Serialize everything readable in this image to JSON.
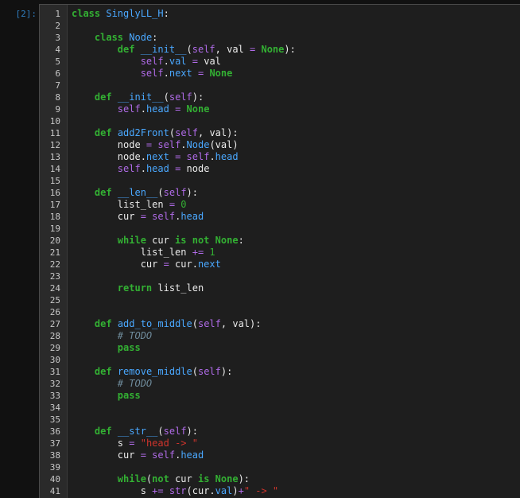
{
  "cell": {
    "prompt": "[2]:",
    "lines": [
      {
        "n": "1",
        "tokens": [
          [
            "kw",
            "class"
          ],
          [
            "text",
            " "
          ],
          [
            "name",
            "SinglyLL_H"
          ],
          [
            "text",
            ":"
          ]
        ]
      },
      {
        "n": "2",
        "tokens": []
      },
      {
        "n": "3",
        "tokens": [
          [
            "text",
            "    "
          ],
          [
            "kw",
            "class"
          ],
          [
            "text",
            " "
          ],
          [
            "name",
            "Node"
          ],
          [
            "text",
            ":"
          ]
        ]
      },
      {
        "n": "4",
        "tokens": [
          [
            "text",
            "        "
          ],
          [
            "kw",
            "def"
          ],
          [
            "text",
            " "
          ],
          [
            "name",
            "__init__"
          ],
          [
            "text",
            "("
          ],
          [
            "self",
            "self"
          ],
          [
            "text",
            ", val "
          ],
          [
            "op",
            "="
          ],
          [
            "text",
            " "
          ],
          [
            "none",
            "None"
          ],
          [
            "text",
            "):"
          ]
        ]
      },
      {
        "n": "5",
        "tokens": [
          [
            "text",
            "            "
          ],
          [
            "self",
            "self"
          ],
          [
            "text",
            "."
          ],
          [
            "attr",
            "val"
          ],
          [
            "text",
            " "
          ],
          [
            "op",
            "="
          ],
          [
            "text",
            " val"
          ]
        ]
      },
      {
        "n": "6",
        "tokens": [
          [
            "text",
            "            "
          ],
          [
            "self",
            "self"
          ],
          [
            "text",
            "."
          ],
          [
            "attr",
            "next"
          ],
          [
            "text",
            " "
          ],
          [
            "op",
            "="
          ],
          [
            "text",
            " "
          ],
          [
            "none",
            "None"
          ]
        ]
      },
      {
        "n": "7",
        "tokens": []
      },
      {
        "n": "8",
        "tokens": [
          [
            "text",
            "    "
          ],
          [
            "kw",
            "def"
          ],
          [
            "text",
            " "
          ],
          [
            "name",
            "__init__"
          ],
          [
            "text",
            "("
          ],
          [
            "self",
            "self"
          ],
          [
            "text",
            "):"
          ]
        ]
      },
      {
        "n": "9",
        "tokens": [
          [
            "text",
            "        "
          ],
          [
            "self",
            "self"
          ],
          [
            "text",
            "."
          ],
          [
            "attr",
            "head"
          ],
          [
            "text",
            " "
          ],
          [
            "op",
            "="
          ],
          [
            "text",
            " "
          ],
          [
            "none",
            "None"
          ]
        ]
      },
      {
        "n": "10",
        "tokens": []
      },
      {
        "n": "11",
        "tokens": [
          [
            "text",
            "    "
          ],
          [
            "kw",
            "def"
          ],
          [
            "text",
            " "
          ],
          [
            "name",
            "add2Front"
          ],
          [
            "text",
            "("
          ],
          [
            "self",
            "self"
          ],
          [
            "text",
            ", val):"
          ]
        ]
      },
      {
        "n": "12",
        "tokens": [
          [
            "text",
            "        node "
          ],
          [
            "op",
            "="
          ],
          [
            "text",
            " "
          ],
          [
            "self",
            "self"
          ],
          [
            "text",
            "."
          ],
          [
            "attr",
            "Node"
          ],
          [
            "text",
            "(val)"
          ]
        ]
      },
      {
        "n": "13",
        "tokens": [
          [
            "text",
            "        node."
          ],
          [
            "attr",
            "next"
          ],
          [
            "text",
            " "
          ],
          [
            "op",
            "="
          ],
          [
            "text",
            " "
          ],
          [
            "self",
            "self"
          ],
          [
            "text",
            "."
          ],
          [
            "attr",
            "head"
          ]
        ]
      },
      {
        "n": "14",
        "tokens": [
          [
            "text",
            "        "
          ],
          [
            "self",
            "self"
          ],
          [
            "text",
            "."
          ],
          [
            "attr",
            "head"
          ],
          [
            "text",
            " "
          ],
          [
            "op",
            "="
          ],
          [
            "text",
            " node"
          ]
        ]
      },
      {
        "n": "15",
        "tokens": []
      },
      {
        "n": "16",
        "tokens": [
          [
            "text",
            "    "
          ],
          [
            "kw",
            "def"
          ],
          [
            "text",
            " "
          ],
          [
            "name",
            "__len__"
          ],
          [
            "text",
            "("
          ],
          [
            "self",
            "self"
          ],
          [
            "text",
            "):"
          ]
        ]
      },
      {
        "n": "17",
        "tokens": [
          [
            "text",
            "        list_len "
          ],
          [
            "op",
            "="
          ],
          [
            "text",
            " "
          ],
          [
            "num",
            "0"
          ]
        ]
      },
      {
        "n": "18",
        "tokens": [
          [
            "text",
            "        cur "
          ],
          [
            "op",
            "="
          ],
          [
            "text",
            " "
          ],
          [
            "self",
            "self"
          ],
          [
            "text",
            "."
          ],
          [
            "attr",
            "head"
          ]
        ]
      },
      {
        "n": "19",
        "tokens": []
      },
      {
        "n": "20",
        "tokens": [
          [
            "text",
            "        "
          ],
          [
            "kw",
            "while"
          ],
          [
            "text",
            " cur "
          ],
          [
            "kw",
            "is"
          ],
          [
            "text",
            " "
          ],
          [
            "kw",
            "not"
          ],
          [
            "text",
            " "
          ],
          [
            "none",
            "None"
          ],
          [
            "text",
            ":"
          ]
        ]
      },
      {
        "n": "21",
        "tokens": [
          [
            "text",
            "            list_len "
          ],
          [
            "op",
            "+="
          ],
          [
            "text",
            " "
          ],
          [
            "num",
            "1"
          ]
        ]
      },
      {
        "n": "22",
        "tokens": [
          [
            "text",
            "            cur "
          ],
          [
            "op",
            "="
          ],
          [
            "text",
            " cur."
          ],
          [
            "attr",
            "next"
          ]
        ]
      },
      {
        "n": "23",
        "tokens": []
      },
      {
        "n": "24",
        "tokens": [
          [
            "text",
            "        "
          ],
          [
            "kw",
            "return"
          ],
          [
            "text",
            " list_len"
          ]
        ]
      },
      {
        "n": "25",
        "tokens": []
      },
      {
        "n": "26",
        "tokens": []
      },
      {
        "n": "27",
        "tokens": [
          [
            "text",
            "    "
          ],
          [
            "kw",
            "def"
          ],
          [
            "text",
            " "
          ],
          [
            "name",
            "add_to_middle"
          ],
          [
            "text",
            "("
          ],
          [
            "self",
            "self"
          ],
          [
            "text",
            ", val):"
          ]
        ]
      },
      {
        "n": "28",
        "tokens": [
          [
            "text",
            "        "
          ],
          [
            "cm",
            "# TODO"
          ]
        ]
      },
      {
        "n": "29",
        "tokens": [
          [
            "text",
            "        "
          ],
          [
            "kw",
            "pass"
          ]
        ]
      },
      {
        "n": "30",
        "tokens": []
      },
      {
        "n": "31",
        "tokens": [
          [
            "text",
            "    "
          ],
          [
            "kw",
            "def"
          ],
          [
            "text",
            " "
          ],
          [
            "name",
            "remove_middle"
          ],
          [
            "text",
            "("
          ],
          [
            "self",
            "self"
          ],
          [
            "text",
            "):"
          ]
        ]
      },
      {
        "n": "32",
        "tokens": [
          [
            "text",
            "        "
          ],
          [
            "cm",
            "# TODO"
          ]
        ]
      },
      {
        "n": "33",
        "tokens": [
          [
            "text",
            "        "
          ],
          [
            "kw",
            "pass"
          ]
        ]
      },
      {
        "n": "34",
        "tokens": []
      },
      {
        "n": "35",
        "tokens": []
      },
      {
        "n": "36",
        "tokens": [
          [
            "text",
            "    "
          ],
          [
            "kw",
            "def"
          ],
          [
            "text",
            " "
          ],
          [
            "name",
            "__str__"
          ],
          [
            "text",
            "("
          ],
          [
            "self",
            "self"
          ],
          [
            "text",
            "):"
          ]
        ]
      },
      {
        "n": "37",
        "tokens": [
          [
            "text",
            "        s "
          ],
          [
            "op",
            "="
          ],
          [
            "text",
            " "
          ],
          [
            "str",
            "\"head -> \""
          ]
        ]
      },
      {
        "n": "38",
        "tokens": [
          [
            "text",
            "        cur "
          ],
          [
            "op",
            "="
          ],
          [
            "text",
            " "
          ],
          [
            "self",
            "self"
          ],
          [
            "text",
            "."
          ],
          [
            "attr",
            "head"
          ]
        ]
      },
      {
        "n": "39",
        "tokens": []
      },
      {
        "n": "40",
        "tokens": [
          [
            "text",
            "        "
          ],
          [
            "kw",
            "while"
          ],
          [
            "text",
            "("
          ],
          [
            "kw",
            "not"
          ],
          [
            "text",
            " cur "
          ],
          [
            "kw",
            "is"
          ],
          [
            "text",
            " "
          ],
          [
            "none",
            "None"
          ],
          [
            "text",
            "):"
          ]
        ]
      },
      {
        "n": "41",
        "tokens": [
          [
            "text",
            "            s "
          ],
          [
            "op",
            "+="
          ],
          [
            "text",
            " "
          ],
          [
            "bi",
            "str"
          ],
          [
            "text",
            "(cur."
          ],
          [
            "attr",
            "val"
          ],
          [
            "text",
            ")"
          ],
          [
            "op",
            "+"
          ],
          [
            "str",
            "\" -> \""
          ]
        ]
      }
    ]
  },
  "colors": {
    "background": "#111111",
    "cell_background": "#1e1e1e",
    "gutter_background": "#2a2a2a",
    "prompt": "#307fc1",
    "keyword": "#33b033",
    "name": "#4aa8ff",
    "self": "#b06be8",
    "string": "#d0342c",
    "comment": "#6f8b9b"
  }
}
